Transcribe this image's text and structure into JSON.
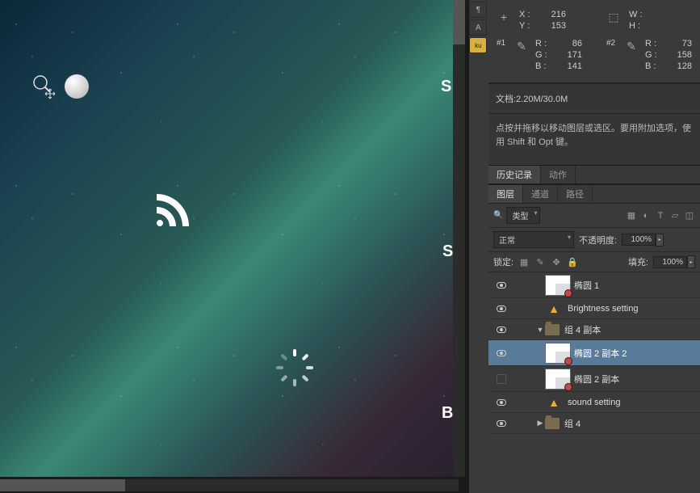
{
  "info": {
    "pos": {
      "x_label": "X :",
      "x_value": "216",
      "y_label": "Y :",
      "y_value": "153"
    },
    "dim": {
      "w_label": "W :",
      "w_value": "",
      "h_label": "H :",
      "h_value": ""
    },
    "sampler1": {
      "id": "#1",
      "r_label": "R :",
      "r_value": "86",
      "g_label": "G :",
      "g_value": "171",
      "b_label": "B :",
      "b_value": "141"
    },
    "sampler2": {
      "id": "#2",
      "r_label": "R :",
      "r_value": "73",
      "g_label": "G :",
      "g_value": "158",
      "b_label": "B :",
      "b_value": "128"
    },
    "doc": "文档:2.20M/30.0M",
    "hint": "点按并拖移以移动图层或选区。要用附加选项，使用 Shift 和 Opt 键。"
  },
  "history_tabs": {
    "history": "历史记录",
    "actions": "动作"
  },
  "layer_tabs": {
    "layers": "图层",
    "channels": "通道",
    "paths": "路径"
  },
  "layer_opts": {
    "kind_label": "类型",
    "blend_mode": "正常",
    "opacity_label": "不透明度:",
    "opacity_value": "100%",
    "lock_label": "锁定:",
    "fill_label": "填充:",
    "fill_value": "100%"
  },
  "layers": {
    "l1": "椭圆 1",
    "l2": "Brightness setting",
    "l3": "组 4 副本",
    "l4": "椭圆 2 副本 2",
    "l5": "椭圆 2 副本",
    "l6": "sound setting",
    "l7": "组 4"
  },
  "canvas_labels": {
    "s1": "S",
    "s2": "S",
    "b": "B"
  }
}
